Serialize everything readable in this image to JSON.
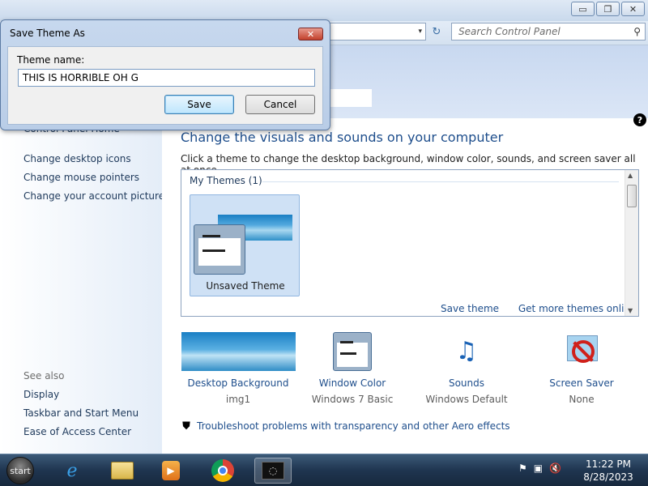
{
  "window": {
    "caption": {
      "minimize": "▭",
      "maximize": "❐",
      "close": "✕"
    },
    "address_tail": "▾",
    "search_placeholder": "Search Control Panel"
  },
  "sidebar": {
    "home_link": "Control Panel Home",
    "items": [
      {
        "label": "Change desktop icons"
      },
      {
        "label": "Change mouse pointers"
      },
      {
        "label": "Change your account picture"
      }
    ],
    "see_also_title": "See also",
    "see_also": [
      {
        "label": "Display"
      },
      {
        "label": "Taskbar and Start Menu"
      },
      {
        "label": "Ease of Access Center"
      }
    ]
  },
  "main": {
    "heading": "Change the visuals and sounds on your computer",
    "subtext": "Click a theme to change the desktop background, window color, sounds, and screen saver all at once.",
    "my_themes_label": "My Themes (1)",
    "theme_card_label": "Unsaved Theme",
    "save_theme_link": "Save theme",
    "get_more_link": "Get more themes online",
    "items": [
      {
        "label": "Desktop Background",
        "value": "img1"
      },
      {
        "label": "Window Color",
        "value": "Windows 7 Basic"
      },
      {
        "label": "Sounds",
        "value": "Windows Default"
      },
      {
        "label": "Screen Saver",
        "value": "None"
      }
    ],
    "troubleshoot_link": "Troubleshoot problems with transparency and other Aero effects",
    "help": "?"
  },
  "dialog": {
    "title": "Save Theme As",
    "label": "Theme name:",
    "value": "THIS IS HORRIBLE OH G",
    "save_button": "Save",
    "cancel_button": "Cancel",
    "close": "✕"
  },
  "taskbar": {
    "start_label": "start",
    "time": "11:22 PM",
    "date": "8/28/2023"
  },
  "colors": {
    "link": "#1e4e8c",
    "sidebar_link": "#1e395b",
    "taskbar": "#1f3550"
  }
}
